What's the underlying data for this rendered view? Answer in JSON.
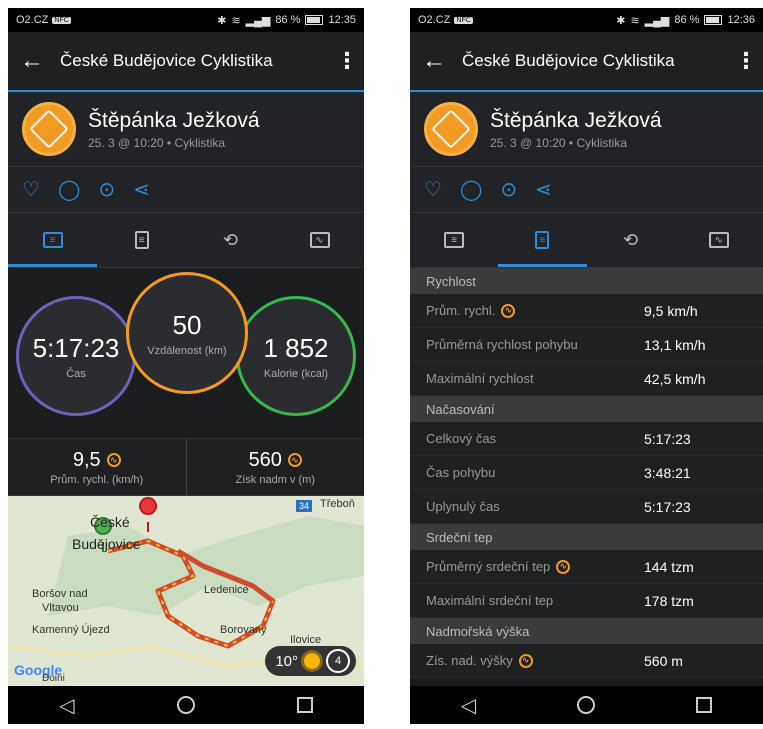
{
  "status_left": {
    "carrier": "O2.CZ",
    "carrier_badge": "NFC",
    "battery": "86 %",
    "time": "12:35"
  },
  "status_right": {
    "carrier": "O2.CZ",
    "carrier_badge": "NFC",
    "battery": "86 %",
    "time": "12:36"
  },
  "appbar": {
    "title": "České Budějovice Cyklistika"
  },
  "activity": {
    "user": "Štěpánka Ježková",
    "meta": "25. 3 @ 10:20 • Cyklistika"
  },
  "circles": [
    {
      "value": "5:17:23",
      "label": "Čas"
    },
    {
      "value": "50",
      "label": "Vzdálenost (km)"
    },
    {
      "value": "1 852",
      "label": "Kalorie (kcal)"
    }
  ],
  "stats": [
    {
      "value": "9,5",
      "label": "Prům. rychl. (km/h)"
    },
    {
      "value": "560",
      "label": "Získ nadm v (m)"
    }
  ],
  "map": {
    "labels": [
      "České",
      "Budějovice",
      "Boršov nad",
      "Vltavou",
      "Kamenný Újezd",
      "Ledenice",
      "Borovany",
      "Třeboň",
      "Google",
      "Doini",
      "34",
      "Ilovice"
    ],
    "temperature": "10°",
    "wind": "4"
  },
  "details": {
    "sections": [
      {
        "title": "Rychlost",
        "rows": [
          {
            "label": "Prům. rychl.",
            "value": "9,5 km/h",
            "warn": true
          },
          {
            "label": "Průměrná rychlost pohybu",
            "value": "13,1 km/h",
            "warn": false
          },
          {
            "label": "Maximální rychlost",
            "value": "42,5 km/h",
            "warn": false
          }
        ]
      },
      {
        "title": "Načasování",
        "rows": [
          {
            "label": "Celkový čas",
            "value": "5:17:23",
            "warn": false
          },
          {
            "label": "Čas pohybu",
            "value": "3:48:21",
            "warn": false
          },
          {
            "label": "Uplynulý čas",
            "value": "5:17:23",
            "warn": false
          }
        ]
      },
      {
        "title": "Srdeční tep",
        "rows": [
          {
            "label": "Průměrný srdeční tep",
            "value": "144 tzm",
            "warn": true
          },
          {
            "label": "Maximální srdeční tep",
            "value": "178 tzm",
            "warn": false
          }
        ]
      },
      {
        "title": "Nadmořská výška",
        "rows": [
          {
            "label": "Zís. nad. výšky",
            "value": "560 m",
            "warn": true
          }
        ]
      }
    ]
  },
  "colors": {
    "accent": "#2c8ed8",
    "time_ring": "#6a63b8",
    "distance_ring": "#f29a22",
    "calorie_ring": "#34b94a"
  }
}
